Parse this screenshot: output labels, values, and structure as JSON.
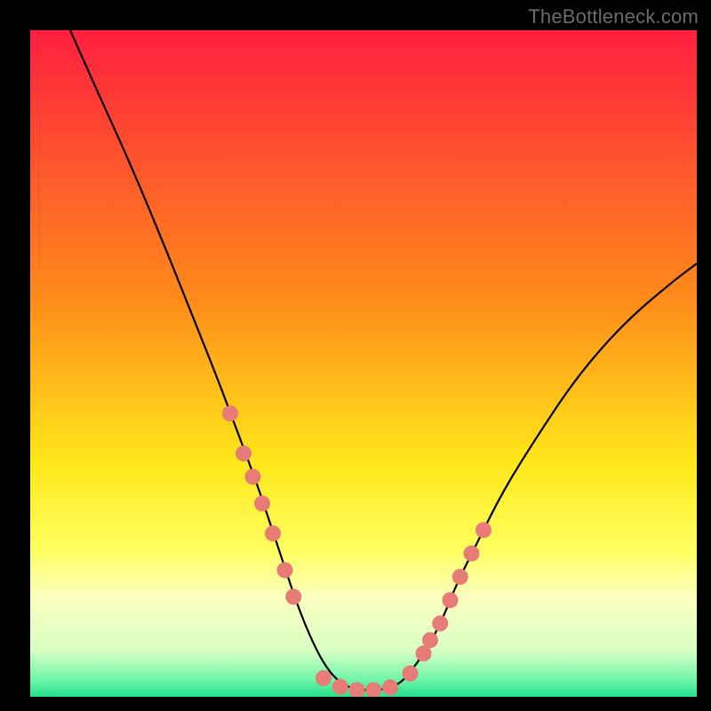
{
  "watermark": "TheBottleneck.com",
  "chart_data": {
    "type": "line",
    "title": "",
    "xlabel": "",
    "ylabel": "",
    "xlim": [
      0,
      100
    ],
    "ylim": [
      0,
      100
    ],
    "grid": false,
    "legend": false,
    "background_gradient": {
      "stops": [
        {
          "offset": 0.0,
          "color": "#ff1f3f"
        },
        {
          "offset": 0.4,
          "color": "#ff8a1a"
        },
        {
          "offset": 0.65,
          "color": "#ffe81a"
        },
        {
          "offset": 0.78,
          "color": "#ffff60"
        },
        {
          "offset": 0.85,
          "color": "#fcffbe"
        },
        {
          "offset": 0.93,
          "color": "#d9ffc4"
        },
        {
          "offset": 0.975,
          "color": "#6ef5a8"
        },
        {
          "offset": 1.0,
          "color": "#23e28a"
        }
      ]
    },
    "series": [
      {
        "name": "bottleneck-curve",
        "color": "#000000",
        "stroke_width": 2.2,
        "x": [
          6,
          10,
          15,
          20,
          24,
          28,
          31,
          34,
          36,
          38,
          40,
          42,
          44,
          46,
          48,
          50,
          52,
          54,
          56,
          58,
          60,
          62,
          64,
          67,
          71,
          76,
          82,
          89,
          96,
          100
        ],
        "y": [
          100,
          91,
          80,
          68,
          58,
          48,
          40,
          32,
          26,
          20,
          14,
          9,
          5,
          2.5,
          1.3,
          1.0,
          1.0,
          1.3,
          2.4,
          5,
          8,
          12,
          17,
          23,
          31,
          39,
          48,
          56,
          62,
          65
        ]
      }
    ],
    "markers": {
      "name": "highlighted-points",
      "color": "#e77b76",
      "radius": 9,
      "x": [
        30.0,
        32.0,
        33.4,
        34.8,
        36.4,
        38.2,
        39.5,
        44.0,
        46.5,
        49.0,
        51.5,
        54.0,
        57.0,
        59.0,
        60.0,
        61.5,
        63.0,
        64.5,
        66.2,
        68.0
      ],
      "y": [
        42.5,
        36.5,
        33.0,
        29.0,
        24.5,
        19.0,
        15.0,
        2.8,
        1.5,
        1.0,
        1.0,
        1.4,
        3.5,
        6.5,
        8.5,
        11.0,
        14.5,
        18.0,
        21.5,
        25.0
      ]
    }
  }
}
